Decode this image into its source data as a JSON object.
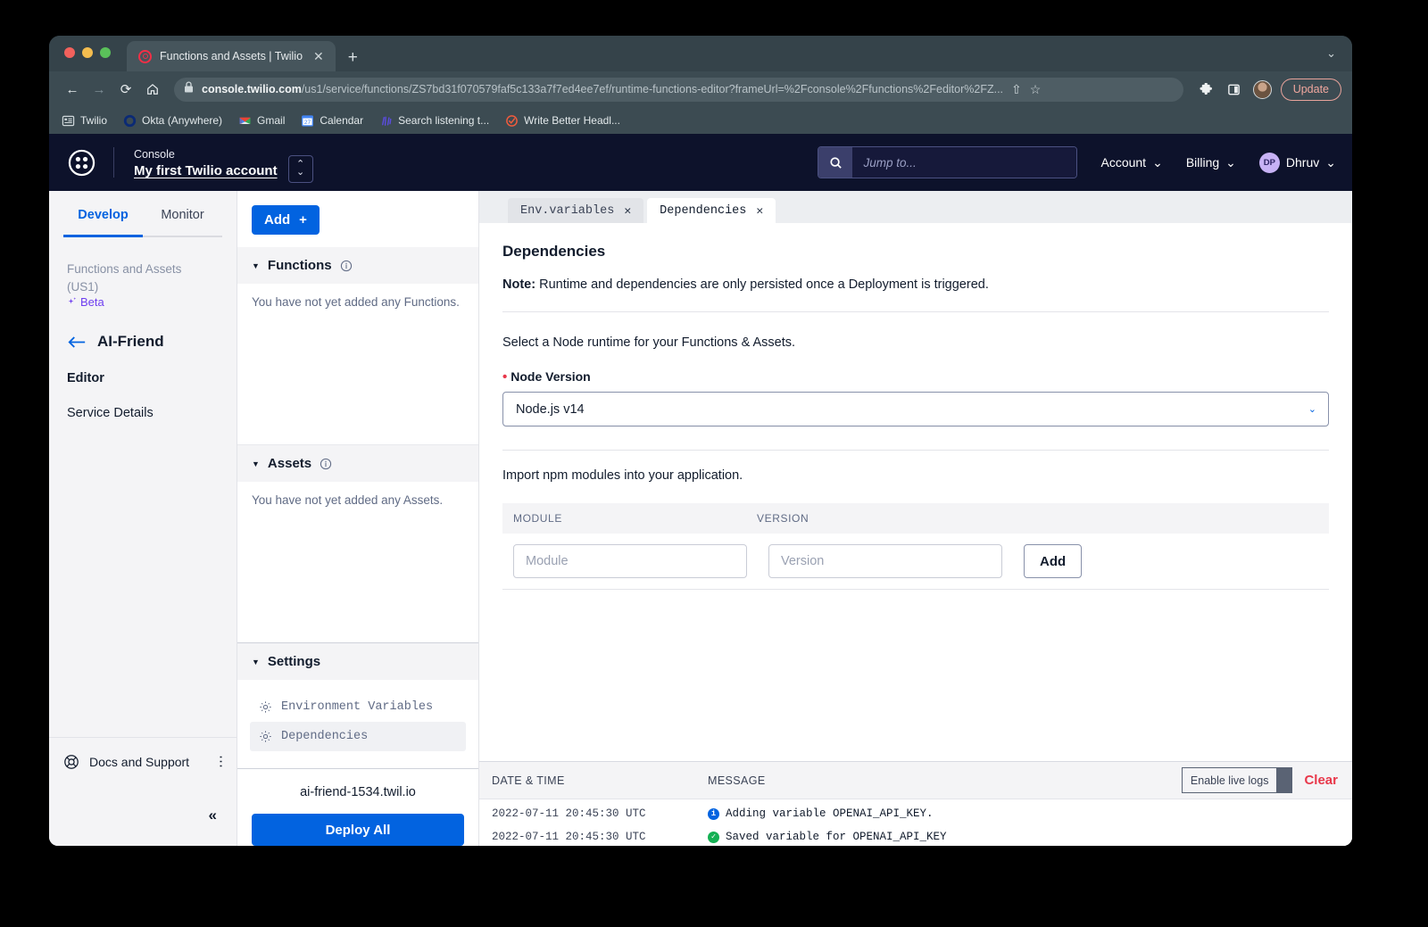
{
  "browser": {
    "tab_title": "Functions and Assets | Twilio",
    "tab_favicon": "twilio-icon",
    "new_tab_label": "+",
    "window_chevron": "chevron-down-icon",
    "close_label": "✕",
    "nav": {
      "back": "←",
      "forward": "→",
      "reload": "⟳",
      "home": "⌂"
    },
    "url_domain": "console.twilio.com",
    "url_path": "/us1/service/functions/ZS7bd31f070579faf5c133a7f7ed4ee7ef/runtime-functions-editor?frameUrl=%2Fconsole%2Ffunctions%2Feditor%2FZ...",
    "update_label": "Update",
    "bookmarks": [
      {
        "label": "Twilio",
        "icon": "twilio-bookmark-icon"
      },
      {
        "label": "Okta (Anywhere)",
        "icon": "okta-icon"
      },
      {
        "label": "Gmail",
        "icon": "gmail-icon"
      },
      {
        "label": "Calendar",
        "icon": "calendar-icon"
      },
      {
        "label": "Search listening t...",
        "icon": "search-listening-icon"
      },
      {
        "label": "Write Better Headl...",
        "icon": "write-better-icon"
      }
    ]
  },
  "topnav": {
    "console_label": "Console",
    "account_name": "My first Twilio account",
    "account_switcher_icon": "up-down-chevron-icon",
    "search_placeholder": "Jump to...",
    "search_value": "",
    "menu_account": "Account",
    "menu_billing": "Billing",
    "user_initials": "DP",
    "user_name": "Dhruv"
  },
  "sidebar": {
    "tabs": [
      {
        "label": "Develop",
        "active": true
      },
      {
        "label": "Monitor",
        "active": false
      }
    ],
    "product": "Functions and Assets",
    "region": "(US1)",
    "beta": "Beta",
    "service_name": "AI-Friend",
    "back_icon": "arrow-left-icon",
    "links": [
      {
        "label": "Editor",
        "bold": true
      },
      {
        "label": "Service Details",
        "bold": false
      }
    ],
    "docs_label": "Docs and Support",
    "docs_icon": "lifebuoy-icon",
    "overflow_icon": "kebab-menu-icon",
    "collapse_icon": "double-chevron-left-icon"
  },
  "filepanel": {
    "add_label": "Add",
    "add_plus": "+",
    "functions": {
      "title": "Functions",
      "info_icon": "info-icon",
      "empty": "You have not yet added any Functions."
    },
    "assets": {
      "title": "Assets",
      "info_icon": "info-icon",
      "empty": "You have not yet added any Assets."
    },
    "settings": {
      "title": "Settings",
      "items": [
        {
          "label": "Environment Variables",
          "icon": "gear-icon",
          "active": false
        },
        {
          "label": "Dependencies",
          "icon": "gear-icon",
          "active": true
        }
      ]
    },
    "service_url": "ai-friend-1534.twil.io",
    "deploy_label": "Deploy All"
  },
  "editor": {
    "tabs": [
      {
        "label": "Env.variables",
        "active": false,
        "close": "✕"
      },
      {
        "label": "Dependencies",
        "active": true,
        "close": "✕"
      }
    ],
    "title": "Dependencies",
    "note_prefix": "Note:",
    "note_body": " Runtime and dependencies are only persisted once a Deployment is triggered.",
    "runtime_text": "Select a Node runtime for your Functions & Assets.",
    "node_version_label": "Node Version",
    "node_version_required": "•",
    "node_version_value": "Node.js v14",
    "node_version_chevron": "chevron-down-icon",
    "npm_text": "Import npm modules into your application.",
    "table": {
      "col_module": "MODULE",
      "col_version": "VERSION",
      "module_placeholder": "Module",
      "module_value": "",
      "version_placeholder": "Version",
      "version_value": "",
      "add_label": "Add"
    }
  },
  "logs": {
    "col_datetime": "DATE & TIME",
    "col_message": "MESSAGE",
    "toggle_label": "Enable live logs",
    "clear_label": "Clear",
    "rows": [
      {
        "datetime": "2022-07-11 20:45:30 UTC",
        "level": "info",
        "message": "Adding variable OPENAI_API_KEY."
      },
      {
        "datetime": "2022-07-11 20:45:30 UTC",
        "level": "ok",
        "message": "Saved variable for OPENAI_API_KEY"
      }
    ]
  },
  "colors": {
    "accent_blue": "#0263e0",
    "twilio_red": "#f22f46",
    "nav_navy": "#0d122b",
    "danger": "#e8374a",
    "success": "#14b053",
    "beta_purple": "#6e3ef0"
  }
}
